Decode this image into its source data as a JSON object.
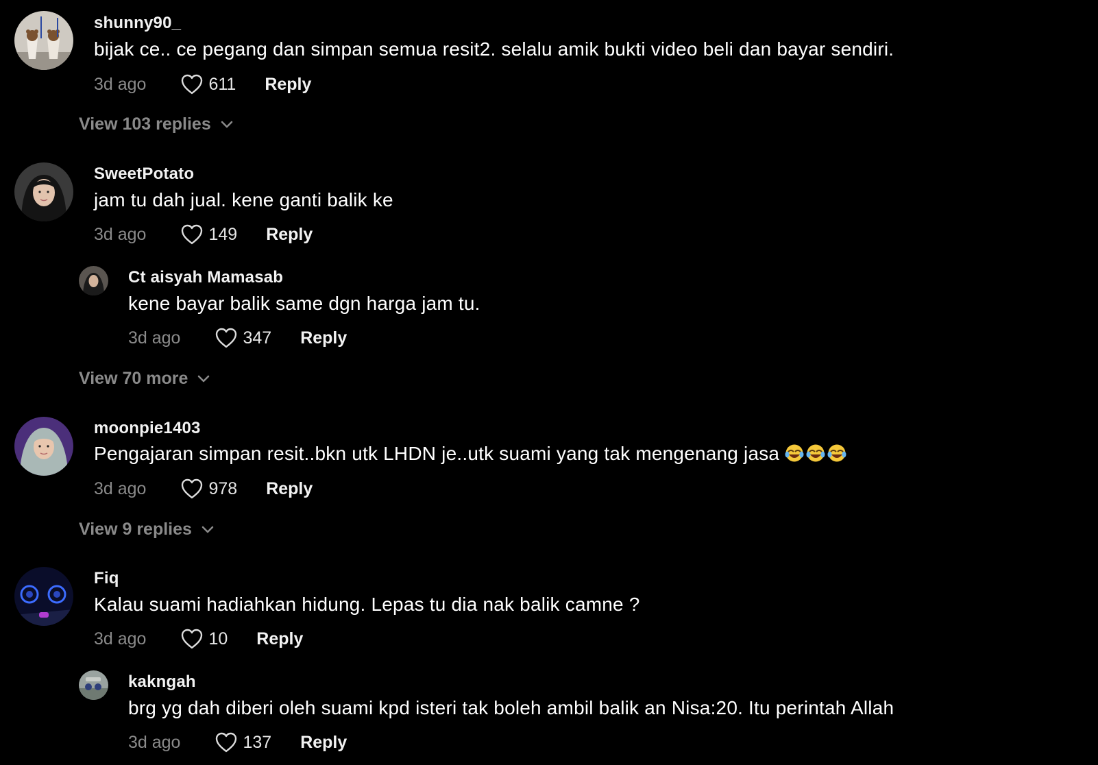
{
  "comments": [
    {
      "username": "shunny90_",
      "text": "bijak ce.. ce pegang dan simpan semua resit2. selalu amik bukti video beli dan bayar sendiri.",
      "time": "3d ago",
      "likes": "611",
      "reply_label": "Reply",
      "view_more": "View 103 replies",
      "avatar_icon": "avatar-icon"
    },
    {
      "username": "SweetPotato",
      "text": "jam tu dah jual. kene ganti balik ke",
      "time": "3d ago",
      "likes": "149",
      "reply_label": "Reply",
      "avatar_icon": "avatar-icon",
      "replies": [
        {
          "username": "Ct aisyah Mamasab",
          "text": "kene bayar balik same dgn harga jam tu.",
          "time": "3d ago",
          "likes": "347",
          "reply_label": "Reply"
        }
      ],
      "view_more": "View 70 more"
    },
    {
      "username": "moonpie1403",
      "text": "Pengajaran simpan resit..bkn utk LHDN je..utk suami yang tak mengenang jasa ",
      "emoji": "😂😂😂",
      "time": "3d ago",
      "likes": "978",
      "reply_label": "Reply",
      "view_more": "View 9 replies"
    },
    {
      "username": "Fiq",
      "text": "Kalau suami hadiahkan hidung. Lepas tu dia nak balik camne ?",
      "time": "3d ago",
      "likes": "10",
      "reply_label": "Reply",
      "replies": [
        {
          "username": "kakngah",
          "text": "brg yg dah diberi oleh suami kpd isteri tak boleh ambil balik an Nisa:20. Itu perintah Allah",
          "time": "3d ago",
          "likes": "137",
          "reply_label": "Reply"
        }
      ]
    }
  ],
  "colors": {
    "background": "#000000",
    "text_primary": "#ffffff",
    "text_secondary": "#8a8a8a"
  }
}
